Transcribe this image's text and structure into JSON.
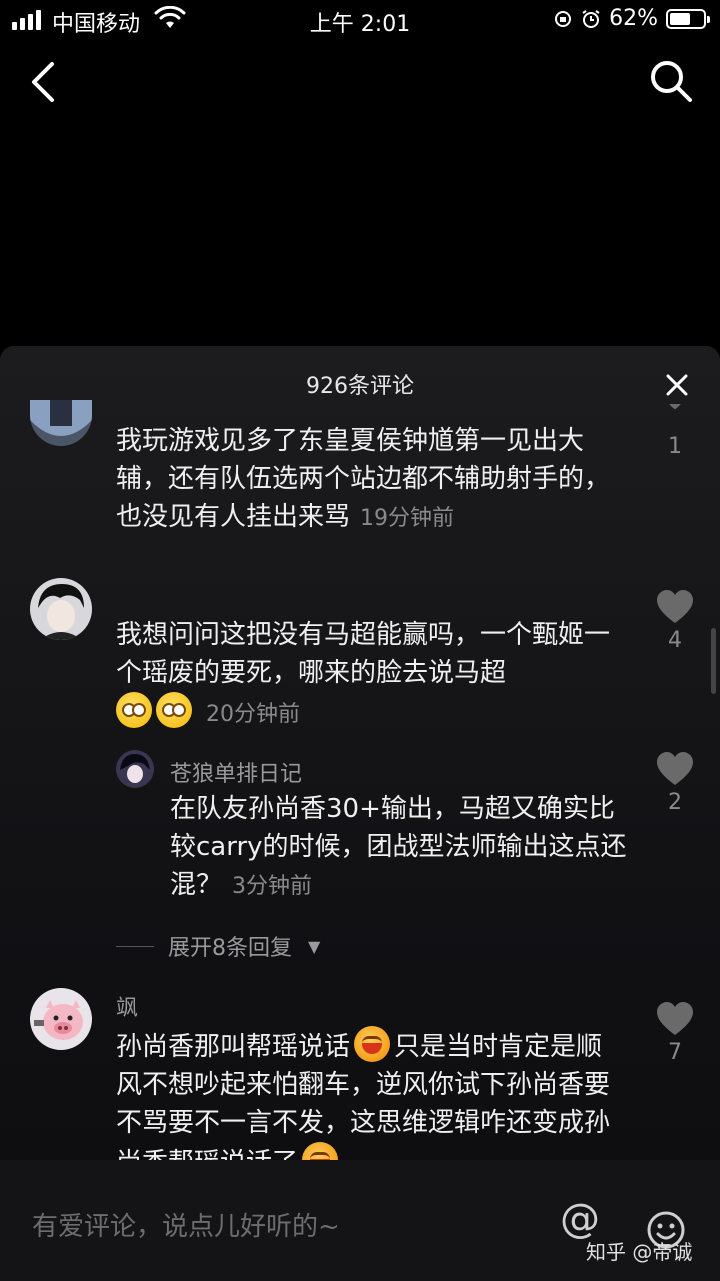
{
  "status_bar": {
    "carrier": "中国移动",
    "time": "上午 2:01",
    "battery_text": "62%",
    "battery_level": 0.62
  },
  "sheet": {
    "title": "926条评论"
  },
  "comments": [
    {
      "text": "我玩游戏见多了东皇夏侯钟馗第一见出大辅，还有队伍选两个站边都不辅助射手的，也没见有人挂出来骂",
      "time": "19分钟前",
      "likes": "1"
    },
    {
      "text": "我想问问这把没有马超能赢吗，一个甄姬一个瑶废的要死，哪来的脸去说马超",
      "time": "20分钟前",
      "likes": "4",
      "reply": {
        "username": "苍狼单排日记",
        "text": "在队友孙尚香30+输出，马超又确实比较carry的时候，团战型法师输出这点还混？",
        "time": "3分钟前",
        "likes": "2"
      },
      "expand_label": "展开8条回复"
    },
    {
      "username": "飒",
      "text_a": "孙尚香那叫帮瑶说话",
      "text_b": "只是当时肯定是顺风不想吵起来怕翻车，逆风你试下孙尚香要不骂要不一言不发，这思维逻辑咋还变成孙尚香帮瑶说话了",
      "likes": "7"
    }
  ],
  "input": {
    "placeholder": "有爱评论，说点儿好听的~",
    "at_symbol": "@"
  },
  "watermark": "知乎 @帝诚",
  "icons": [
    "signal-icon",
    "wifi-icon",
    "battery-icon",
    "back-icon",
    "search-icon",
    "close-icon",
    "heart-icon",
    "emoji-icon"
  ]
}
